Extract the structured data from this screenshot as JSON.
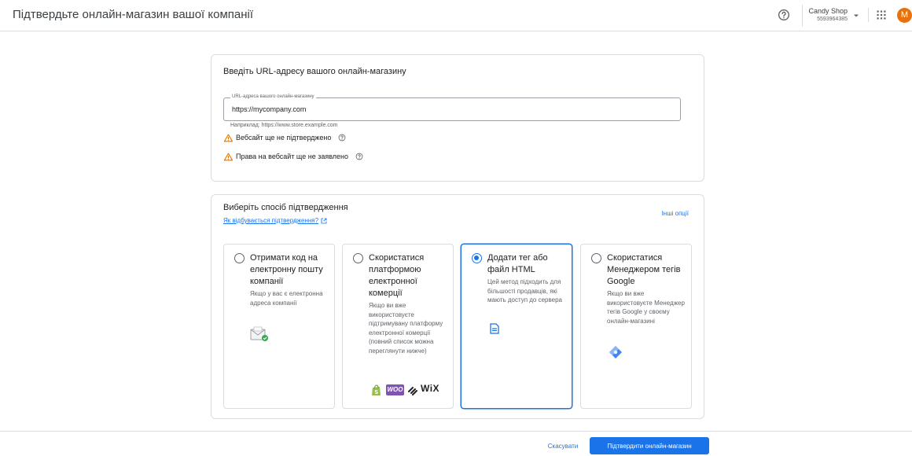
{
  "header": {
    "title": "Підтвердьте онлайн-магазин вашої компанії",
    "help_icon": "help-circle-icon",
    "account": {
      "name": "Candy Shop",
      "id": "5593964385"
    },
    "apps_icon": "apps-grid-icon",
    "avatar_letter": "M"
  },
  "url_card": {
    "title": "Введіть URL-адресу вашого онлайн-магазину",
    "field_label": "URL-адреса вашого онлайн-магазину",
    "field_value": "https://mycompany.com",
    "hint": "Наприклад: https://www.store.example.com",
    "warnings": [
      {
        "text": "Вебсайт ще не підтверджено",
        "icon": "warning-triangle-icon"
      },
      {
        "text": "Права на вебсайт ще не заявлено",
        "icon": "warning-triangle-icon"
      }
    ]
  },
  "method_card": {
    "title": "Виберіть спосіб підтвердження",
    "help_link": "Як відбувається підтвердження?",
    "other_options": "Інші опції",
    "options": [
      {
        "title": "Отримати код на електронну пошту компанії",
        "desc": "Якщо у вас є електронна адреса компанії",
        "selected": false,
        "icon": "email-verified-icon"
      },
      {
        "title": "Скористатися платформою електронної комерції",
        "desc": "Якщо ви вже використовуєте підтримувану платформу електронної комерції (повний список можна переглянути нижче)",
        "selected": false,
        "icon": "ecommerce-platforms-icon",
        "logos": [
          "WOO",
          "WiX"
        ]
      },
      {
        "title": "Додати тег або файл HTML",
        "desc": "Цей метод підходить для більшості продавців, які мають доступ до сервера",
        "selected": true,
        "icon": "html-file-icon"
      },
      {
        "title": "Скористатися Менеджером тегів Google",
        "desc": "Якщо ви вже використовуєте Менеджер тегів Google у своєму онлайн-магазині",
        "selected": false,
        "icon": "google-tag-manager-icon"
      }
    ]
  },
  "footer": {
    "cancel": "Скасувати",
    "confirm": "Підтвердити онлайн-магазин"
  },
  "colors": {
    "accent": "#1a73e8",
    "warning": "#e37400",
    "avatar": "#e8710a"
  }
}
